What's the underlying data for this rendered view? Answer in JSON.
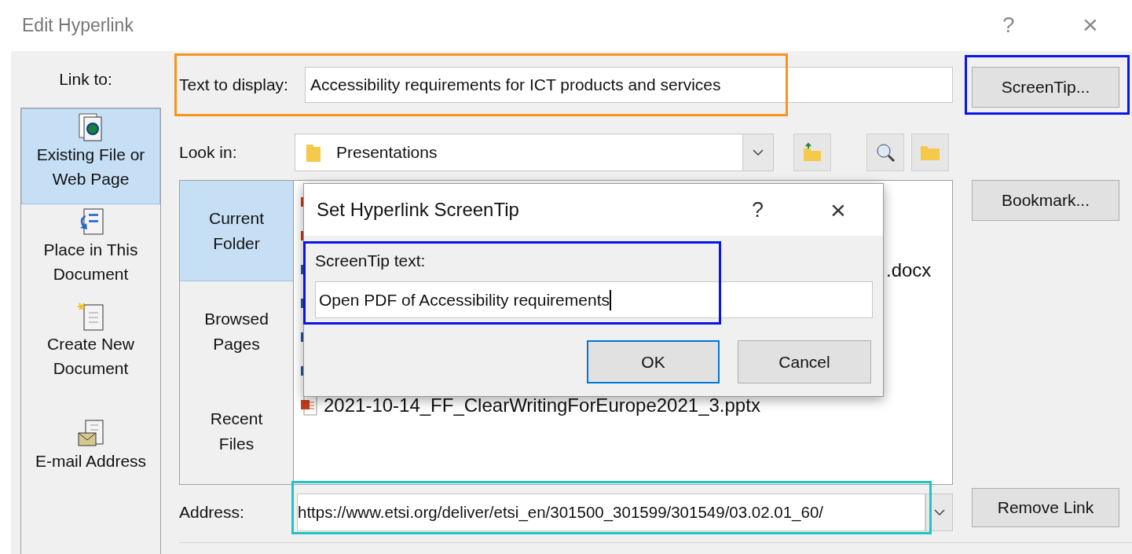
{
  "window": {
    "title": "Edit Hyperlink",
    "help": "?",
    "close": "×"
  },
  "link_to": {
    "label": "Link to:",
    "items": [
      {
        "label": "Existing File or Web Page",
        "kind": "web",
        "selected": true
      },
      {
        "label": "Place in This Document",
        "kind": "place",
        "selected": false
      },
      {
        "label": "Create New Document",
        "kind": "new",
        "selected": false
      },
      {
        "label": "E-mail Address",
        "kind": "email",
        "selected": false
      }
    ]
  },
  "text_to_display": {
    "label": "Text to display:",
    "value": "Accessibility requirements for ICT products and services",
    "color": "#f7941d"
  },
  "screentip_button": {
    "label": "ScreenTip...",
    "color": "#0a14e6"
  },
  "look_in": {
    "label": "Look in:",
    "value": "Presentations"
  },
  "browse_nav": [
    {
      "label": "Current Folder",
      "selected": true
    },
    {
      "label": "Browsed Pages",
      "selected": false
    },
    {
      "label": "Recent Files",
      "selected": false
    }
  ],
  "files": [
    {
      "kind": "pptx"
    },
    {
      "kind": "pptx"
    },
    {
      "kind": "docx",
      "name": ".docx"
    },
    {
      "kind": "docx"
    },
    {
      "kind": "docx"
    },
    {
      "kind": "docx"
    },
    {
      "kind": "pptx",
      "name": "2021-10-14_FF_ClearWritingForEurope2021_3.pptx"
    }
  ],
  "bookmark_button": {
    "label": "Bookmark..."
  },
  "address": {
    "label": "Address:",
    "value": "https://www.etsi.org/deliver/etsi_en/301500_301599/301549/03.02.01_60/",
    "color": "#22c3c3"
  },
  "remove_link_button": {
    "label": "Remove Link"
  },
  "screentip_dialog": {
    "title": "Set Hyperlink ScreenTip",
    "help": "?",
    "close": "×",
    "label": "ScreenTip text:",
    "value": "Open PDF of Accessibility requirements",
    "color": "#0a14e6",
    "buttons": [
      {
        "label": "OK",
        "default": true
      },
      {
        "label": "Cancel",
        "default": false
      }
    ]
  }
}
